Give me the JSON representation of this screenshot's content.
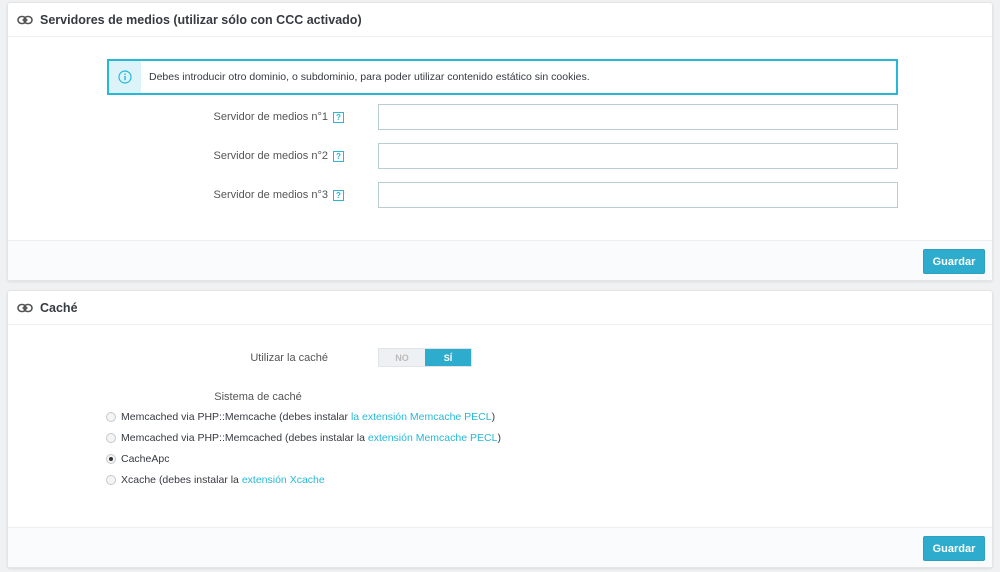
{
  "media_panel": {
    "title": "Servidores de medios (utilizar sólo con CCC activado)",
    "alert": "Debes introducir otro dominio, o subdominio, para poder utilizar contenido estático sin cookies.",
    "help_glyph": "?",
    "fields": [
      {
        "label": "Servidor de medios n°1",
        "value": ""
      },
      {
        "label": "Servidor de medios n°2",
        "value": ""
      },
      {
        "label": "Servidor de medios n°3",
        "value": ""
      }
    ],
    "save_label": "Guardar"
  },
  "cache_panel": {
    "title": "Caché",
    "use_cache_label": "Utilizar la caché",
    "switch": {
      "off_label": "NO",
      "on_label": "SÍ",
      "value": "SÍ"
    },
    "system_label": "Sistema de caché",
    "options": [
      {
        "text": "Memcached via PHP::Memcache (debes instalar ",
        "link": "la extensión Memcache PECL",
        "suffix": ")",
        "checked": false
      },
      {
        "text": "Memcached via PHP::Memcached (debes instalar la ",
        "link": "extensión Memcache PECL",
        "suffix": ")",
        "checked": false
      },
      {
        "text": "CacheApc",
        "link": "",
        "suffix": "",
        "checked": true
      },
      {
        "text": "Xcache (debes instalar la ",
        "link": "extensión Xcache",
        "suffix": "",
        "checked": false
      }
    ],
    "save_label": "Guardar"
  },
  "colors": {
    "accent": "#25b9d7",
    "button": "#2eacce",
    "background": "#eff1f2"
  }
}
